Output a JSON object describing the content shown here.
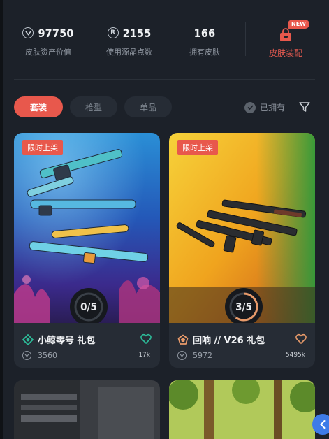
{
  "stats": [
    {
      "value": "97750",
      "label": "皮肤资产价值",
      "icon": "value-coin-icon"
    },
    {
      "value": "2155",
      "label": "使用源晶点数",
      "icon": "radianite-coin-icon"
    },
    {
      "value": "166",
      "label": "拥有皮肤"
    }
  ],
  "outfit": {
    "label": "皮肤装配",
    "badge": "NEW",
    "icon": "outfit-bag-icon"
  },
  "filters": {
    "tabs": [
      {
        "label": "套装",
        "active": true
      },
      {
        "label": "枪型",
        "active": false
      },
      {
        "label": "单品",
        "active": false
      }
    ],
    "owned_label": "已拥有",
    "filter_icon": "funnel-icon"
  },
  "cards": [
    {
      "tag": "限时上架",
      "progress": "0/5",
      "progress_value": 0,
      "name": "小鲸零号 礼包",
      "price": "3560",
      "likes": "17k",
      "tier_color": "#2dbd9a",
      "heart_color": "#2dbd9a"
    },
    {
      "tag": "限时上架",
      "progress": "3/5",
      "progress_value": 0.6,
      "name": "回响 // V26 礼包",
      "price": "5972",
      "likes": "5495k",
      "tier_color": "#e89a6a",
      "heart_color": "#e89a6a"
    }
  ],
  "colors": {
    "accent": "#e8584c",
    "background": "#1c2129",
    "card": "#262c35",
    "fab": "#3d7be8"
  },
  "fab": {
    "icon": "chevron-left-icon"
  }
}
